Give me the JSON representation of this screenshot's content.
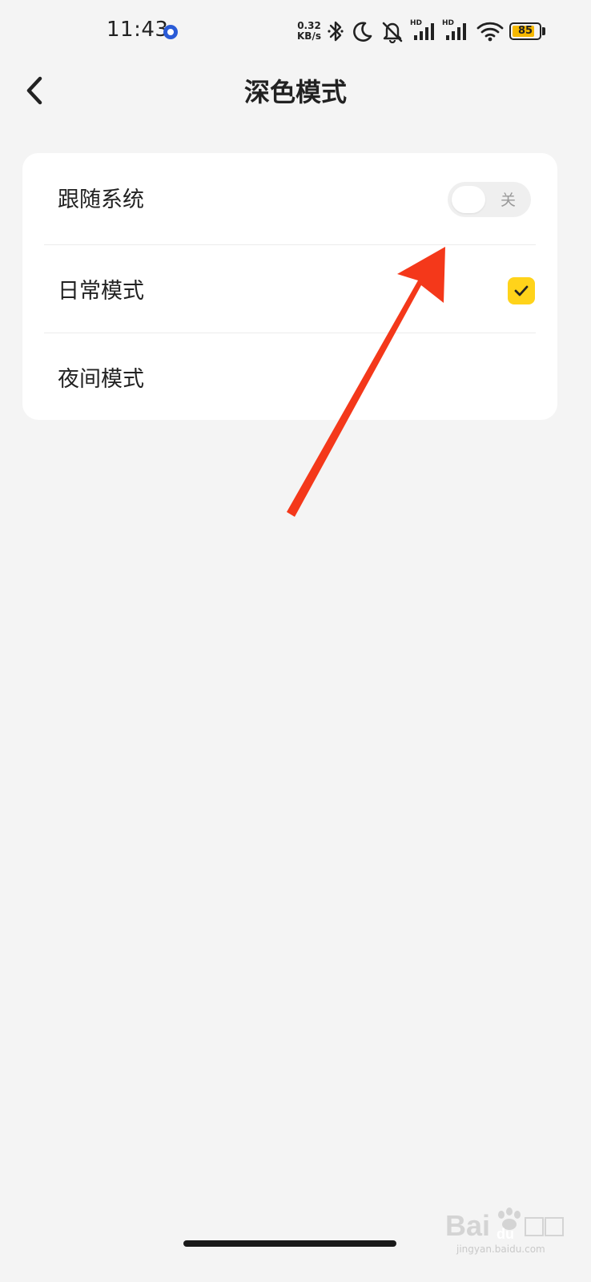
{
  "status_bar": {
    "time": "11:43",
    "speed_value": "0.32",
    "speed_unit": "KB/s",
    "hd1": "HD",
    "hd2": "HD",
    "battery": "85",
    "battery_level": 0.85,
    "icons": [
      "app-notification-icon",
      "bluetooth-icon",
      "moon-icon",
      "mute-icon",
      "signal-icon",
      "signal-icon",
      "wifi-icon",
      "battery-icon"
    ]
  },
  "header": {
    "back_icon": "chevron-left-icon",
    "title": "深色模式"
  },
  "settings": {
    "follow_system": {
      "label": "跟随系统",
      "toggle_state": "关"
    },
    "day_mode": {
      "label": "日常模式",
      "selected": true
    },
    "night_mode": {
      "label": "夜间模式",
      "selected": false
    }
  },
  "colors": {
    "accent": "#ffd31a",
    "annotation": "#f4381a",
    "background": "#f4f4f4",
    "card": "#ffffff"
  },
  "watermark": {
    "text": "jingyan.baidu.com"
  }
}
